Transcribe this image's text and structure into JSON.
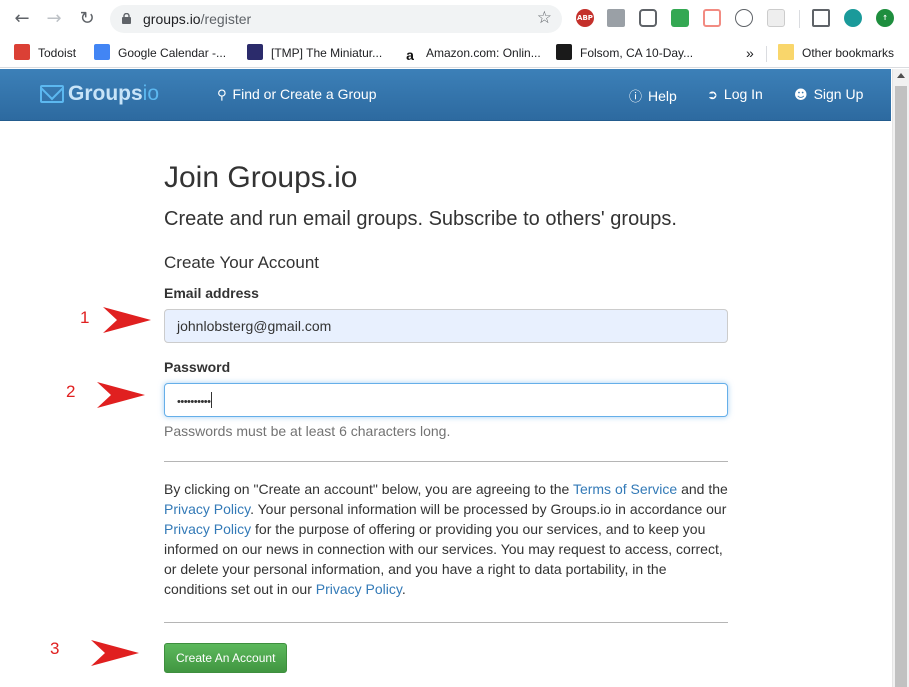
{
  "browser": {
    "url_host": "groups.io",
    "url_path": "/register",
    "extensions": [
      "ABP"
    ],
    "bookmarks": [
      {
        "label": "Todoist",
        "color": "#db4035"
      },
      {
        "label": "Google Calendar -...",
        "color": "#4285f4",
        "badge": "13"
      },
      {
        "label": "[TMP] The Miniatur...",
        "color": "#2b2b6b",
        "badge": "TMP"
      },
      {
        "label": "Amazon.com: Onlin...",
        "color": "#ff9900",
        "badge": "a"
      },
      {
        "label": "Folsom, CA 10-Day...",
        "color": "#1a1a1a"
      }
    ],
    "overflow": "»",
    "other_bookmarks": "Other bookmarks"
  },
  "site": {
    "brand": "Groups",
    "brand_suffix": "io",
    "nav": {
      "find": "Find or Create a Group",
      "help": "Help",
      "login": "Log In",
      "signup": "Sign Up"
    }
  },
  "form": {
    "title": "Join Groups.io",
    "subtitle": "Create and run email groups. Subscribe to others' groups.",
    "section": "Create Your Account",
    "email_label": "Email address",
    "email_value": "johnlobsterg@gmail.com",
    "password_label": "Password",
    "password_value": "••••••••••",
    "password_help": "Passwords must be at least 6 characters long.",
    "terms": {
      "p1": "By clicking on \"Create an account\" below, you are agreeing to the ",
      "tos": "Terms of Service",
      "p2": " and the ",
      "privacy1": "Privacy Policy",
      "p3": ". Your personal information will be processed by Groups.io in accordance our ",
      "privacy2": "Privacy Policy",
      "p4": " for the purpose of offering or providing you our services, and to keep you informed on our news in connection with our services. You may request to access, correct, or delete your personal information, and you have a right to data portability, in the conditions set out in our ",
      "privacy3": "Privacy Policy",
      "p5": "."
    },
    "submit": "Create An Account"
  },
  "annotations": [
    "1",
    "2",
    "3"
  ],
  "colors": {
    "nav_bg": "#3c80b8",
    "link": "#337ab7",
    "button": "#4cae4c",
    "annotation": "#e02020"
  }
}
